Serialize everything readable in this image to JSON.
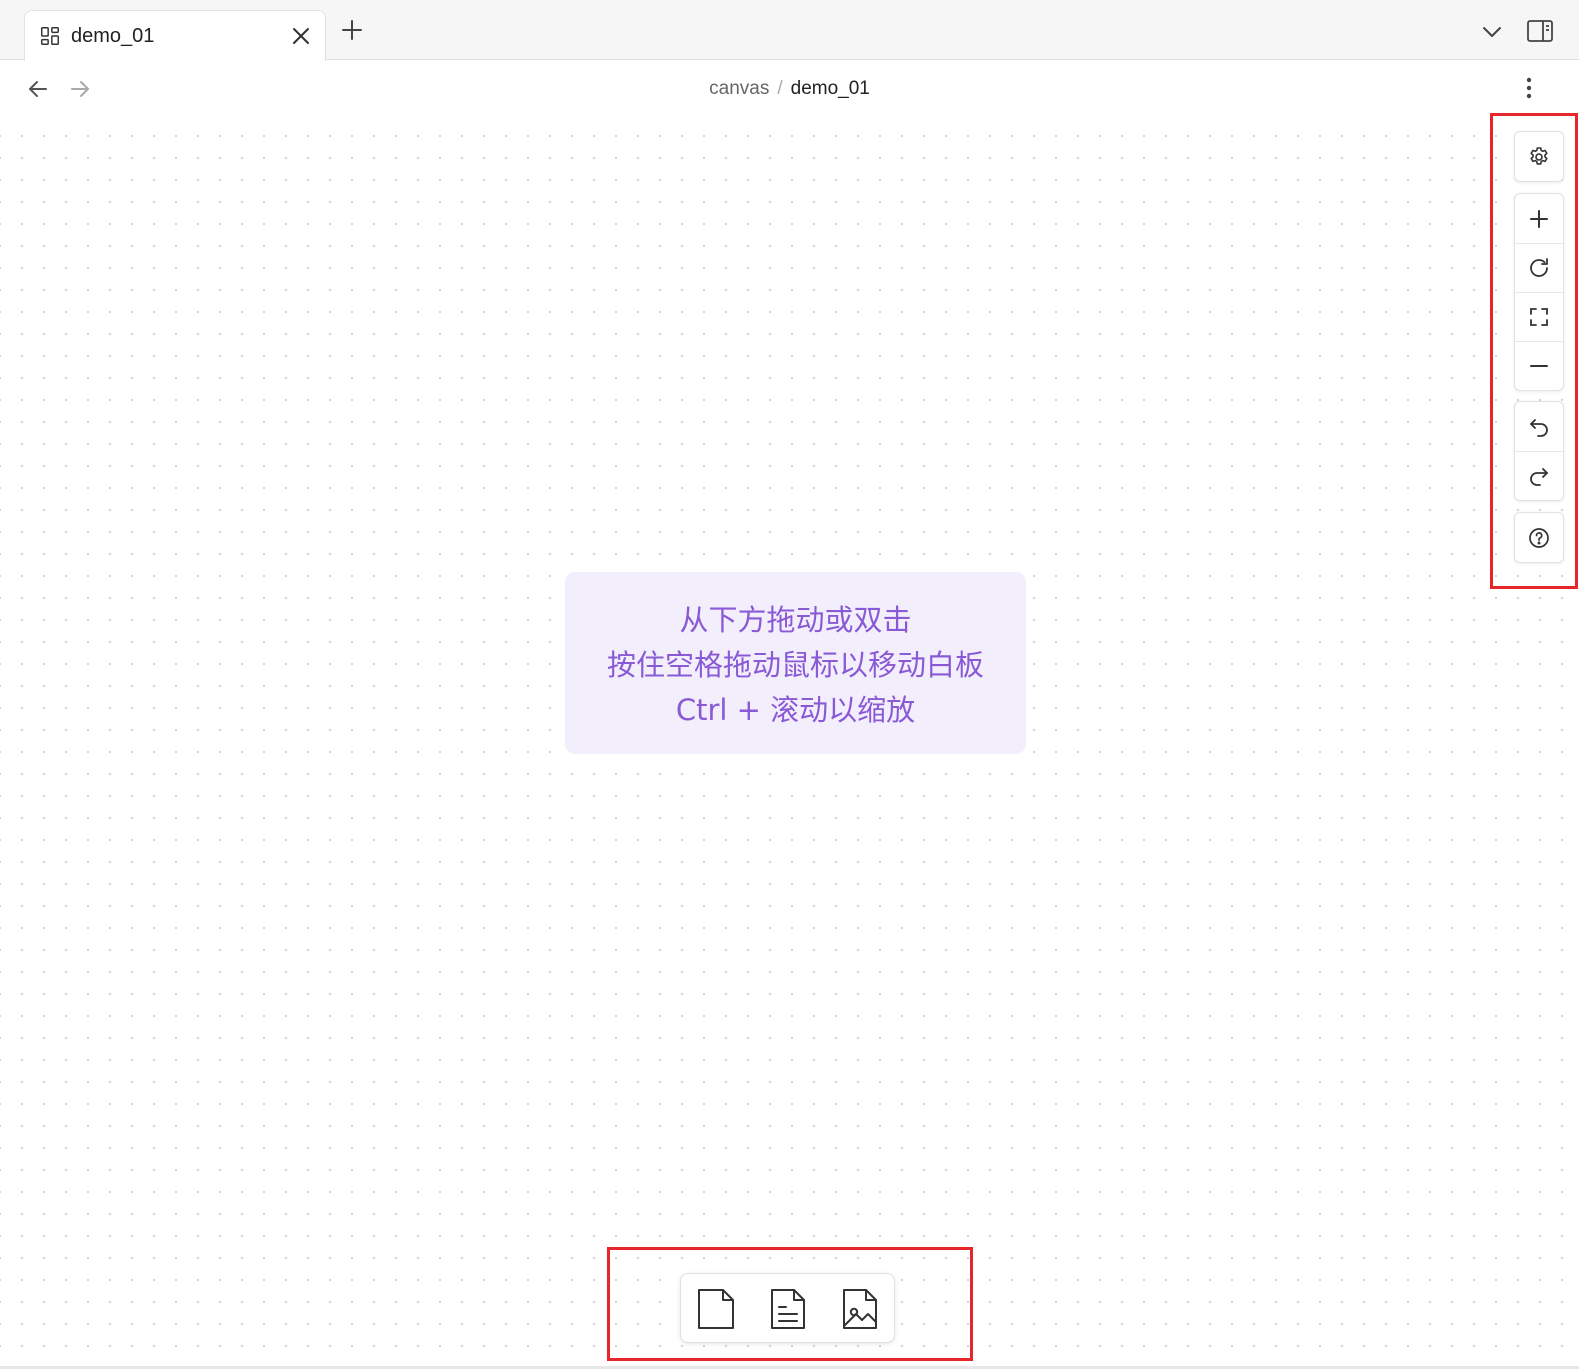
{
  "tabbar": {
    "active_tab": {
      "title": "demo_01",
      "icon": "layout-dashboard-icon"
    },
    "new_tab_icon": "plus-icon",
    "tab_list_icon": "chevron-down-icon",
    "sidebar_toggle_icon": "sidebar-right-icon"
  },
  "nav": {
    "breadcrumb": {
      "parent": "canvas",
      "separator": "/",
      "current": "demo_01"
    },
    "back_icon": "arrow-left-icon",
    "forward_icon": "arrow-right-icon",
    "more_icon": "more-vertical-icon"
  },
  "canvas": {
    "hint": {
      "line1": "从下方拖动或双击",
      "line2": "按住空格拖动鼠标以移动白板",
      "line3": "Ctrl + 滚动以缩放"
    }
  },
  "right_toolbar": {
    "groups": [
      [
        "settings-icon"
      ],
      [
        "zoom-in-icon",
        "reset-zoom-icon",
        "zoom-to-fit-icon",
        "zoom-out-icon"
      ],
      [
        "undo-icon",
        "redo-icon"
      ],
      [
        "help-icon"
      ]
    ]
  },
  "bottom_toolbar": {
    "items": [
      "empty-card-icon",
      "note-card-icon",
      "media-card-icon"
    ]
  },
  "colors": {
    "highlight": "#e6262b",
    "hint_bg": "#f3eefc",
    "hint_text": "#8a5ad6",
    "canvas_dot": "#d4d4d4"
  }
}
